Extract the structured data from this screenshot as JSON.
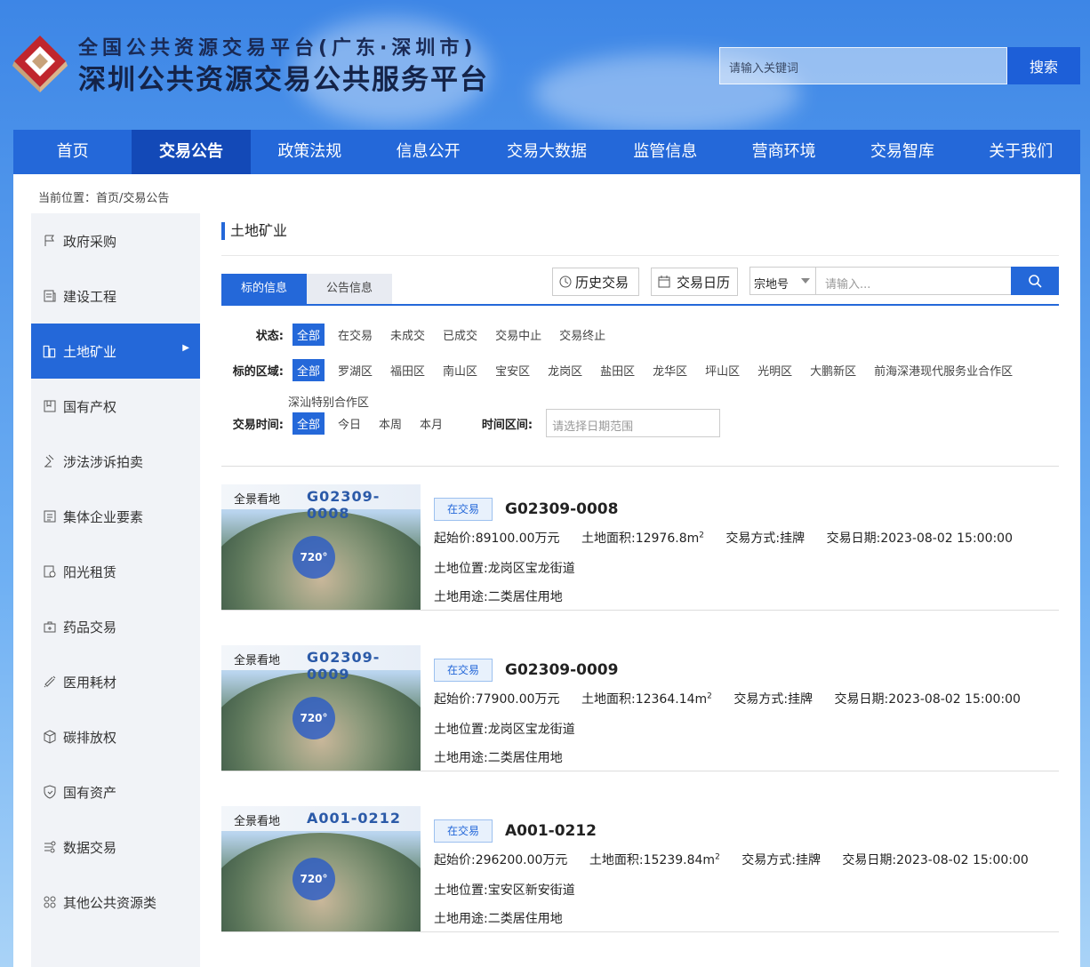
{
  "header": {
    "title_line1": "全国公共资源交易平台(广东·深圳市)",
    "title_line2": "深圳公共资源交易公共服务平台",
    "search_placeholder": "请输入关键词",
    "search_button": "搜索"
  },
  "nav": [
    "首页",
    "交易公告",
    "政策法规",
    "信息公开",
    "交易大数据",
    "监管信息",
    "营商环境",
    "交易智库",
    "关于我们"
  ],
  "breadcrumb": "当前位置：首页/交易公告",
  "sidebar": {
    "items": [
      "政府采购",
      "建设工程",
      "土地矿业",
      "国有产权",
      "涉法涉诉拍卖",
      "集体企业要素",
      "阳光租赁",
      "药品交易",
      "医用耗材",
      "碳排放权",
      "国有资产",
      "数据交易",
      "其他公共资源类"
    ],
    "active": "土地矿业"
  },
  "main": {
    "section_title": "土地矿业",
    "tabs": [
      "标的信息",
      "公告信息"
    ],
    "history_button": "历史交易",
    "calendar_button": "交易日历",
    "select_value": "宗地号",
    "keyword_placeholder": "请输入...",
    "filters": {
      "status_label": "状态:",
      "status_options": [
        "全部",
        "在交易",
        "未成交",
        "已成交",
        "交易中止",
        "交易终止"
      ],
      "area_label": "标的区域:",
      "area_options": [
        "全部",
        "罗湖区",
        "福田区",
        "南山区",
        "宝安区",
        "龙岗区",
        "盐田区",
        "龙华区",
        "坪山区",
        "光明区",
        "大鹏新区",
        "前海深港现代服务业合作区",
        "深汕特别合作区"
      ],
      "time_label": "交易时间:",
      "time_options": [
        "全部",
        "今日",
        "本周",
        "本月"
      ],
      "range_label": "时间区间:",
      "range_placeholder": "请选择日期范围"
    }
  },
  "listings": [
    {
      "brand": "全景看地",
      "code": "G02309-0008",
      "badge": "720°",
      "status": "在交易",
      "price_label": "起始价:",
      "price": "89100.00万元",
      "area_label": "土地面积:",
      "area": "12976.8m",
      "area_unit_sup": "2",
      "method_label": "交易方式:",
      "method": "挂牌",
      "date_label": "交易日期:",
      "date": "2023-08-02 15:00:00",
      "location_label": "土地位置:",
      "location": "龙岗区宝龙街道",
      "use_label": "土地用途:",
      "use": "二类居住用地"
    },
    {
      "brand": "全景看地",
      "code": "G02309-0009",
      "badge": "720°",
      "status": "在交易",
      "price_label": "起始价:",
      "price": "77900.00万元",
      "area_label": "土地面积:",
      "area": "12364.14m",
      "area_unit_sup": "2",
      "method_label": "交易方式:",
      "method": "挂牌",
      "date_label": "交易日期:",
      "date": "2023-08-02 15:00:00",
      "location_label": "土地位置:",
      "location": "龙岗区宝龙街道",
      "use_label": "土地用途:",
      "use": "二类居住用地"
    },
    {
      "brand": "全景看地",
      "code": "A001-0212",
      "badge": "720°",
      "status": "在交易",
      "price_label": "起始价:",
      "price": "296200.00万元",
      "area_label": "土地面积:",
      "area": "15239.84m",
      "area_unit_sup": "2",
      "method_label": "交易方式:",
      "method": "挂牌",
      "date_label": "交易日期:",
      "date": "2023-08-02 15:00:00",
      "location_label": "土地位置:",
      "location": "宝安区新安街道",
      "use_label": "土地用途:",
      "use": "二类居住用地"
    }
  ],
  "colors": {
    "primary": "#2468d9",
    "nav_active": "#1349b7"
  }
}
